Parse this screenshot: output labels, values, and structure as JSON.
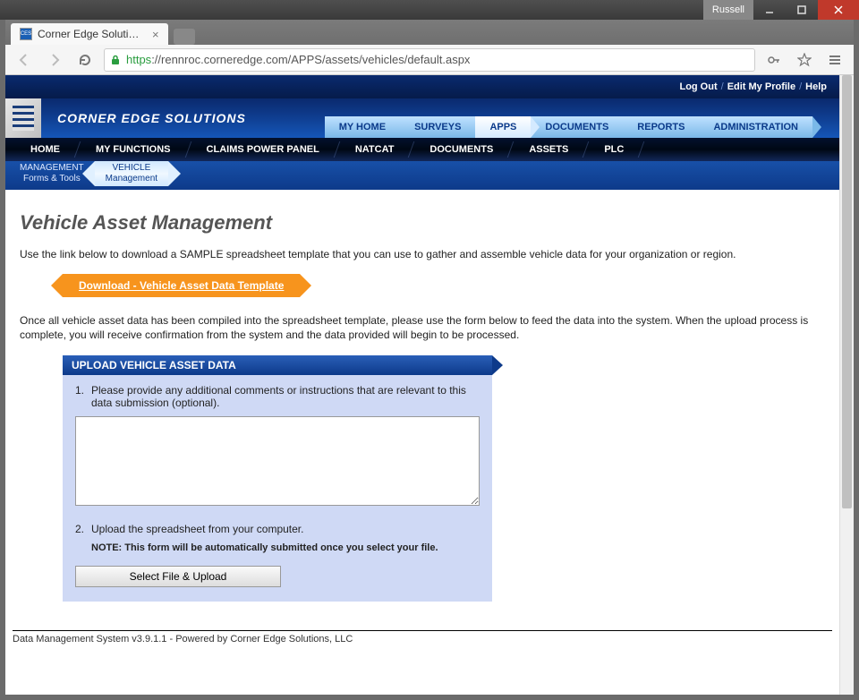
{
  "os": {
    "user": "Russell"
  },
  "browser": {
    "tab_title": "Corner Edge Solutions: Da",
    "url_prefix": "https",
    "url_rest": "://rennroc.corneredge.com/APPS/assets/vehicles/default.aspx"
  },
  "header": {
    "top_links": {
      "logout": "Log Out",
      "edit_profile": "Edit My Profile",
      "help": "Help"
    },
    "brand": "CORNER EDGE SOLUTIONS",
    "top_tabs": [
      "MY HOME",
      "SURVEYS",
      "APPS",
      "DOCUMENTS",
      "REPORTS",
      "ADMINISTRATION"
    ],
    "top_tab_active": 2,
    "dark_nav": [
      "HOME",
      "MY FUNCTIONS",
      "CLAIMS POWER PANEL",
      "NATCAT",
      "DOCUMENTS",
      "ASSETS",
      "PLC"
    ],
    "sub_nav": [
      {
        "line1": "MANAGEMENT",
        "line2": "Forms & Tools",
        "selected": false
      },
      {
        "line1": "VEHICLE",
        "line2": "Management",
        "selected": true
      }
    ]
  },
  "main": {
    "title": "Vehicle Asset Management",
    "intro1": "Use the link below to download a SAMPLE spreadsheet template that you can use to gather and assemble vehicle data for your organization or region.",
    "download_label": "Download - Vehicle Asset Data Template",
    "intro2": "Once all vehicle asset data has been compiled into the spreadsheet template, please use the form below to feed the data into the system. When the upload process is complete, you will receive confirmation from the system and the data provided will begin to be processed.",
    "panel_title": "UPLOAD VEHICLE ASSET DATA",
    "step1_num": "1.",
    "step1_text": "Please provide any additional comments or instructions that are relevant to this data submission (optional).",
    "comments_value": "",
    "step2_num": "2.",
    "step2_text": "Upload the spreadsheet from your computer.",
    "note": "NOTE: This form will be automatically submitted once you select your file.",
    "upload_label": "Select File & Upload"
  },
  "footer": "Data Management System v3.9.1.1 - Powered by Corner Edge Solutions, LLC"
}
